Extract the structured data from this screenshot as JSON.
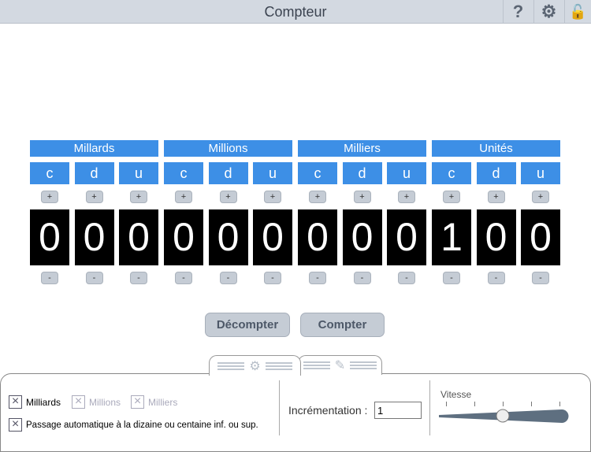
{
  "header": {
    "title": "Compteur",
    "help": "?",
    "settings_icon": "gear-icon",
    "lock_icon": "unlock-icon"
  },
  "groups": [
    "Millards",
    "Millions",
    "Milliers",
    "Unités"
  ],
  "places": [
    "c",
    "d",
    "u",
    "c",
    "d",
    "u",
    "c",
    "d",
    "u",
    "c",
    "d",
    "u"
  ],
  "digits": [
    "0",
    "0",
    "0",
    "0",
    "0",
    "0",
    "0",
    "0",
    "0",
    "1",
    "0",
    "0"
  ],
  "plus": "+",
  "minus": "-",
  "buttons": {
    "decount": "Décompter",
    "count": "Compter"
  },
  "settings": {
    "checkboxes": [
      {
        "label": "Milliards",
        "checked": true,
        "enabled": true
      },
      {
        "label": "Millions",
        "checked": true,
        "enabled": false
      },
      {
        "label": "Milliers",
        "checked": true,
        "enabled": false
      }
    ],
    "auto_label": "Passage automatique à la dizaine ou centaine inf. ou sup.",
    "increment_label": "Incrémentation :",
    "increment_value": "1",
    "speed_label": "Vitesse",
    "speed_value": 0.5
  }
}
